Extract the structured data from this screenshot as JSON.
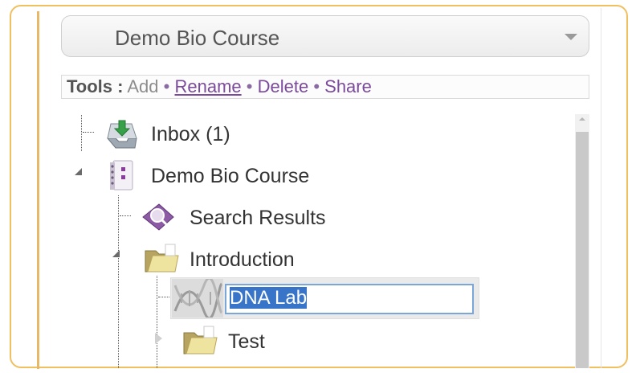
{
  "course_selector": {
    "selected": "Demo Bio Course"
  },
  "toolbar": {
    "label": "Tools :",
    "add": "Add",
    "rename": "Rename",
    "delete": "Delete",
    "share": "Share",
    "separator": "•"
  },
  "tree": {
    "inbox": {
      "label": "Inbox (1)"
    },
    "course": {
      "label": "Demo Bio Course"
    },
    "search_results": {
      "label": "Search Results"
    },
    "introduction": {
      "label": "Introduction"
    },
    "dna_lab": {
      "value": "DNA Lab"
    },
    "test": {
      "label": "Test"
    }
  },
  "colors": {
    "frame_border": "#f0c060",
    "accent": "#e8b868",
    "link": "#7b4a9c",
    "selection": "#3874c8"
  }
}
